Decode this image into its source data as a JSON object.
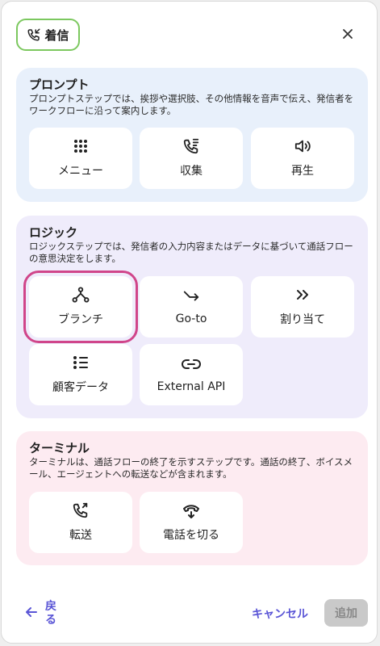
{
  "header": {
    "badge_label": "着信",
    "badge_icon": "phone-incoming-icon",
    "close_icon": "close-icon"
  },
  "sections": {
    "prompt": {
      "title": "プロンプト",
      "description": "プロンプトステップでは、挨拶や選択肢、その他情報を音声で伝え、発信者をワークフローに沿って案内します。",
      "items": [
        {
          "label": "メニュー",
          "icon": "grid-dots-icon"
        },
        {
          "label": "収集",
          "icon": "phone-keypad-icon"
        },
        {
          "label": "再生",
          "icon": "speaker-icon"
        }
      ]
    },
    "logic": {
      "title": "ロジック",
      "description": "ロジックステップでは、発信者の入力内容またはデータに基づいて通話フローの意思決定をします。",
      "items": [
        {
          "label": "ブランチ",
          "icon": "branch-icon"
        },
        {
          "label": "Go-to",
          "icon": "go-to-arrow-icon"
        },
        {
          "label": "割り当て",
          "icon": "double-chevron-icon"
        },
        {
          "label": "顧客データ",
          "icon": "list-icon"
        },
        {
          "label": "External API",
          "icon": "link-icon"
        }
      ]
    },
    "terminal": {
      "title": "ターミナル",
      "description": "ターミナルは、通話フローの終了を示すステップです。通話の終了、ボイスメール、エージェントへの転送などが含まれます。",
      "items": [
        {
          "label": "転送",
          "icon": "phone-transfer-icon"
        },
        {
          "label": "電話を切る",
          "icon": "hang-up-icon"
        }
      ]
    }
  },
  "footer": {
    "back_label": "戻る",
    "cancel_label": "キャンセル",
    "add_label": "追加"
  },
  "colors": {
    "accent": "#5a55d6",
    "selected_outline": "#d0458a",
    "badge_border": "#7cc85f"
  }
}
